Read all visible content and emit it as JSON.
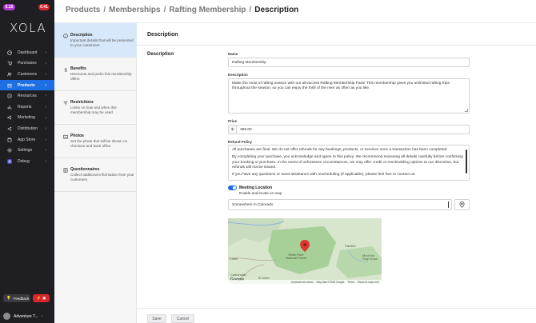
{
  "sidebar": {
    "badge_left": "0.15",
    "badge_right": "0.41",
    "logo": "XOLA",
    "items": [
      {
        "label": "Dashboard",
        "icon": "dashboard-icon"
      },
      {
        "label": "Purchases",
        "icon": "cart-icon"
      },
      {
        "label": "Customers",
        "icon": "users-icon"
      },
      {
        "label": "Products",
        "icon": "box-icon",
        "active": true
      },
      {
        "label": "Resources",
        "icon": "resources-icon"
      },
      {
        "label": "Reports",
        "icon": "chart-icon"
      },
      {
        "label": "Marketing",
        "icon": "megaphone-icon"
      },
      {
        "label": "Distribution",
        "icon": "share-icon"
      },
      {
        "label": "App Store",
        "icon": "store-icon"
      },
      {
        "label": "Settings",
        "icon": "gear-icon"
      },
      {
        "label": "Debug",
        "icon": "x-icon"
      }
    ],
    "feedback_label": "Feedback",
    "account_name": "Adventure T..."
  },
  "header": {
    "crumbs": [
      "Products",
      "Memberships",
      "Rafting Membership",
      "Description"
    ]
  },
  "steps": [
    {
      "title": "Description",
      "desc": "Important details that will be presented to your customers",
      "icon": "info-icon",
      "active": true
    },
    {
      "title": "Benefits",
      "desc": "Discounts and perks this membership offers",
      "icon": "dollar-icon"
    },
    {
      "title": "Restrictions",
      "desc": "Limits on how and when this membership may be used",
      "icon": "filter-icon"
    },
    {
      "title": "Photos",
      "desc": "Set the photo that will be shown on checkout and back office",
      "icon": "photo-icon"
    },
    {
      "title": "Questionnaires",
      "desc": "Collect additional information from your customers",
      "icon": "questionnaire-icon"
    }
  ],
  "main": {
    "section_title": "Description",
    "subsection_title": "Description",
    "name_label": "Name",
    "name_value": "Rafting Membership",
    "desc_label": "Description",
    "desc_value": "Make the most of rafting season with our all-access Rafting Membership Pass! This membership gives you unlimited rafting trips throughout the season, so you can enjoy the thrill of the river as often as you like.",
    "price_label": "Price",
    "price_currency": "$",
    "price_value": "399.00",
    "refund_label": "Refund Policy",
    "refund_p1": "All purchases are final. We do not offer refunds for any bookings, products, or services once a transaction has been completed.",
    "refund_p2": "By completing your purchase, you acknowledge and agree to this policy. We recommend reviewing all details carefully before confirming your booking or purchase. In the event of unforeseen circumstances, we may offer credit or rescheduling options at our discretion, but refunds will not be issued.",
    "refund_p3": "If you have any questions or need assistance with rescheduling (if applicable), please feel free to contact us.",
    "meeting_title": "Meeting Location",
    "meeting_desc": "Enable and locate on map",
    "location_value": "Somewhere in Colorado",
    "map": {
      "forest_label": "White River National Forest",
      "town1": "Fairfield",
      "town2": "Mt of the Holy Cross",
      "town3": "Creek",
      "town4": "Carbondale",
      "town5": "El Jebel",
      "google": "Google",
      "shortcuts": "Keyboard shortcuts",
      "mapdata": "Map data ©2025 Google",
      "terms": "Terms",
      "report": "Report a map error"
    },
    "save_label": "Save",
    "cancel_label": "Cancel"
  }
}
